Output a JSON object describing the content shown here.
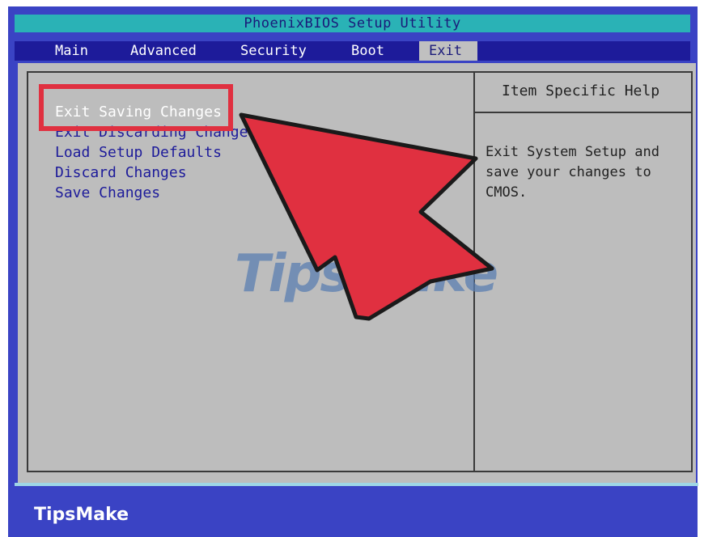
{
  "window": {
    "title": "PhoenixBIOS Setup Utility"
  },
  "menu": {
    "items": [
      "Main",
      "Advanced",
      "Security",
      "Boot",
      "Exit"
    ],
    "active": "Exit"
  },
  "exit_menu": {
    "options": [
      "Exit Saving Changes",
      "Exit Discarding Changes",
      "Load Setup Defaults",
      "Discard Changes",
      "Save Changes"
    ],
    "selected": "Exit Saving Changes"
  },
  "help": {
    "title": "Item Specific Help",
    "lines": [
      "Exit System Setup and",
      "save your changes to",
      "CMOS."
    ]
  },
  "branding": {
    "footer": "TipsMake",
    "watermark": "TipsMake"
  },
  "colors": {
    "frame": "#3a43c4",
    "title_bar": "#2ab2b6",
    "menu_bar": "#1d1b9a",
    "content": "#bdbdbd",
    "highlight": "#e03040",
    "arrow": "#e03040"
  }
}
